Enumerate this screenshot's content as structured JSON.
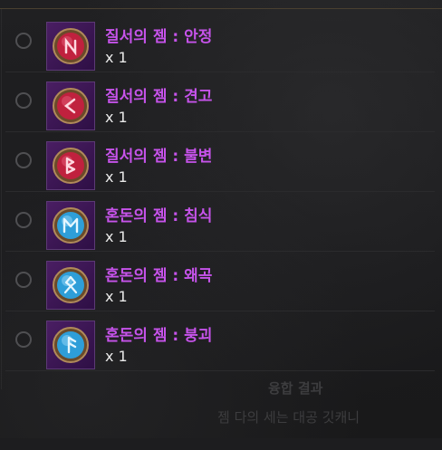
{
  "gems": [
    {
      "name": "질서의 젬 : 안정",
      "qty": "x 1",
      "kind": "order",
      "icon": "rune-n-icon"
    },
    {
      "name": "질서의 젬 : 견고",
      "qty": "x 1",
      "kind": "order",
      "icon": "rune-chevron-icon"
    },
    {
      "name": "질서의 젬 : 불변",
      "qty": "x 1",
      "kind": "order",
      "icon": "rune-b-icon"
    },
    {
      "name": "혼돈의 젬 : 침식",
      "qty": "x 1",
      "kind": "chaos",
      "icon": "rune-m-icon"
    },
    {
      "name": "혼돈의 젬 : 왜곡",
      "qty": "x 1",
      "kind": "chaos",
      "icon": "rune-x-icon"
    },
    {
      "name": "혼돈의 젬 : 붕괴",
      "qty": "x 1",
      "kind": "chaos",
      "icon": "rune-a-icon"
    }
  ],
  "background": {
    "title": "융합 결과",
    "line": "젬 다의 세는 대공 깃캐니"
  },
  "colors": {
    "name": "#c653ea",
    "order_gem": "#c0213e",
    "chaos_gem": "#2e9ed8"
  }
}
